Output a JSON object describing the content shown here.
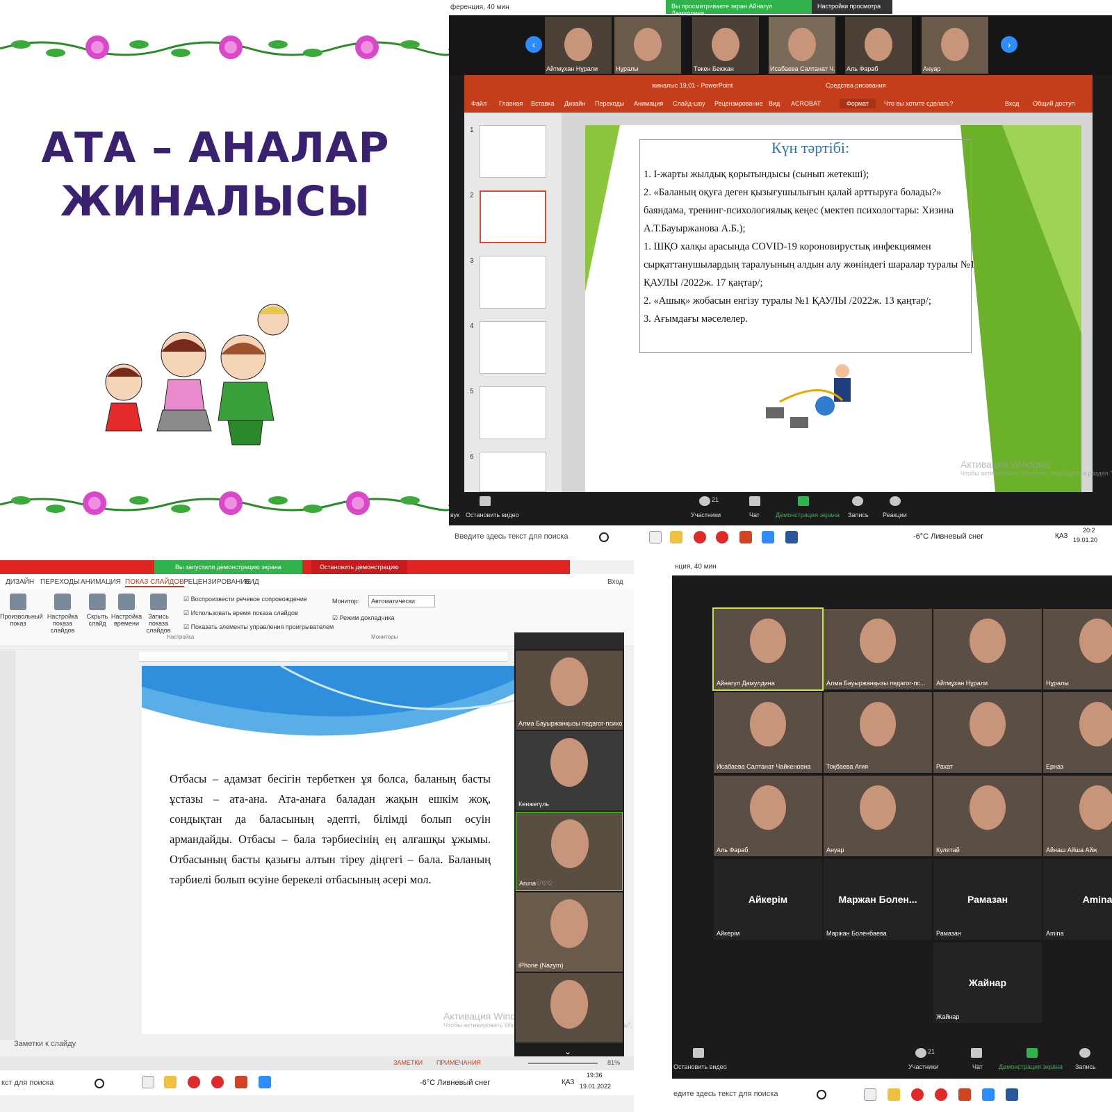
{
  "poster": {
    "title_line1": "АТА – АНАЛАР",
    "title_line2": "ЖИНАЛЫСЫ"
  },
  "zoom_top": {
    "window_title": "ференция, 40 мин",
    "sharing_banner": "Вы просматриваете экран Айнагүл Дамулдина",
    "view_settings": "Настройки просмотра",
    "participants": [
      "Айтмұхан Нұрали",
      "Нұралы",
      "Төкен Бекжан",
      "Исабаева Салтанат Ч...",
      "Аль Фараб",
      "Ануар"
    ],
    "ppt": {
      "title": "жиналыс 19,01 - PowerPoint",
      "drawing_tools": "Средства рисования",
      "menu": [
        "Файл",
        "Главная",
        "Вставка",
        "Дизайн",
        "Переходы",
        "Анимация",
        "Слайд-шоу",
        "Рецензирование",
        "Вид",
        "ACROBAT",
        "Формат"
      ],
      "tell_me": "Что вы хотите сделать?",
      "signin": "Вход",
      "share": "Общий доступ",
      "slide_numbers": [
        "1",
        "2",
        "3",
        "4",
        "5",
        "6"
      ],
      "agenda_title": "Күн тәртібі:",
      "agenda": [
        "1.  І-жарты жылдық қорытындысы (сынып жетекші);",
        "2.  «Баланың оқуға деген қызығушылығын қалай арттыруға болады?» баяндама, тренинг-психологиялық кеңес (мектеп психологтары: Хизина А.Т.Бауыржанова А.Б.);",
        "1.  ШҚО халқы арасында  COVID-19 короновирустық инфекциямен сырқаттанушылардың таралуының алдын алу жөніндегі шаралар туралы №1 ҚАУЛЫ  /2022ж. 17 қаңтар/;",
        "2.  «Ашық» жобасын енгізу туралы №1 ҚАУЛЫ /2022ж. 13 қаңтар/;",
        "3.  Ағымдағы мәселелер."
      ],
      "watermark": "Активация Windows",
      "watermark_sub": "Чтобы активировать Windows, перейдите в раздел \"Параметры\"."
    },
    "controls": {
      "audio": "вук",
      "stop_video": "Остановить видео",
      "participants_label": "Участники",
      "participants_count": "21",
      "chat": "Чат",
      "share_screen": "Демонстрация экрана",
      "record": "Запись",
      "reactions": "Реакции"
    },
    "taskbar": {
      "search": "Введите здесь текст для поиска",
      "weather": "-6°C  Ливневый снег",
      "lang": "ҚАЗ",
      "time": "20:2",
      "date": "19.01.20"
    }
  },
  "ppt_show": {
    "banner_sharing": "Вы запустили демонстрацию экрана",
    "banner_stop": "Остановить демонстрацию",
    "tabs": [
      "ДИЗАЙН",
      "ПЕРЕХОДЫ",
      "АНИМАЦИЯ",
      "ПОКАЗ СЛАЙДОВ",
      "РЕЦЕНЗИРОВАНИЕ",
      "ВИД"
    ],
    "signin": "Вход",
    "ribbon_buttons": [
      "Произвольный показ",
      "Настройка показа слайдов",
      "Скрыть слайд",
      "Настройка времени",
      "Запись показа слайдов"
    ],
    "checks": [
      "Воспроизвести речевое сопровождение",
      "Использовать время показа слайдов",
      "Показать элементы управления проигрывателем"
    ],
    "monitor_label": "Монитор:",
    "monitor_value": "Автоматически",
    "presenter_mode": "Режим докладчика",
    "group_setup": "Настройка",
    "group_monitors": "Мониторы",
    "slide_text": "Отбасы – адамзат бесігін тербеткен ұя болса, баланың басты ұстазы – ата-ана. Ата-анаға баладан жақын ешкім жоқ, сондықтан да баласының әдепті, білімді болып өсуін армандайды. Отбасы – бала тәрбиесінің ең алғашқы ұжымы. Отбасының басты қазығы алтын тіреу діңгегі – бала. Баланың тәрбиелі болып өсуіне берекелі отбасының әсері мол.",
    "notes": "Заметки к слайду",
    "status_notes": "ЗАМЕТКИ",
    "status_comments": "ПРИМЕЧАНИЯ",
    "zoom_level": "81%",
    "side_participants": [
      "Алма Бауыржанқызы педагог-психо...",
      "Кенжегүль",
      "Aruna♡♡♡",
      "iPhone (Nazym)",
      ""
    ],
    "watermark": "Активация Windows",
    "watermark_sub": "Чтобы активировать Windows, перейдите в раздел \"Параметры\".",
    "taskbar": {
      "search": "кст для поиска",
      "weather": "-6°C  Ливневый снег",
      "lang": "ҚАЗ",
      "time": "19:36",
      "date": "19.01.2022"
    }
  },
  "gallery": {
    "window_title": "нция, 40 мин",
    "tiles": [
      {
        "name": "Айнагүл Дамулдина",
        "video": true
      },
      {
        "name": "Алма Бауыржанқызы педагог-пс...",
        "video": true
      },
      {
        "name": "Айтмұхан Нұрали",
        "video": true
      },
      {
        "name": "Нұралы",
        "video": true
      },
      {
        "name": "Исабаева Салтанат Чайкеновна",
        "video": true
      },
      {
        "name": "Тоқбаева Ағия",
        "video": true
      },
      {
        "name": "Рахат",
        "video": true
      },
      {
        "name": "Ерназ",
        "video": true
      },
      {
        "name": "Аль Фараб",
        "video": true
      },
      {
        "name": "Ануар",
        "video": true
      },
      {
        "name": "Кулятай",
        "video": true
      },
      {
        "name": "Айнаш Айша Айж",
        "video": true
      },
      {
        "name": "Айкерім",
        "video": false,
        "big": "Айкерім"
      },
      {
        "name": "Маржан Боленбаева",
        "video": false,
        "big": "Маржан  Болен..."
      },
      {
        "name": "Рамазан",
        "video": false,
        "big": "Рамазан"
      },
      {
        "name": "Amina",
        "video": false,
        "big": "Amina"
      },
      {
        "name": "Жайнар",
        "video": false,
        "big": "Жайнар"
      }
    ],
    "controls": {
      "stop_video": "Остановить видео",
      "participants_label": "Участники",
      "participants_count": "21",
      "chat": "Чат",
      "share_screen": "Демонстрация экрана",
      "record": "Запись"
    },
    "taskbar": {
      "search": "едите здесь текст для поиска"
    }
  },
  "colors": {
    "zoom_blue": "#2d8cff",
    "ppt_red": "#c43e1c",
    "poster_purple": "#3b2270",
    "zoom_green": "#2fb34a"
  }
}
